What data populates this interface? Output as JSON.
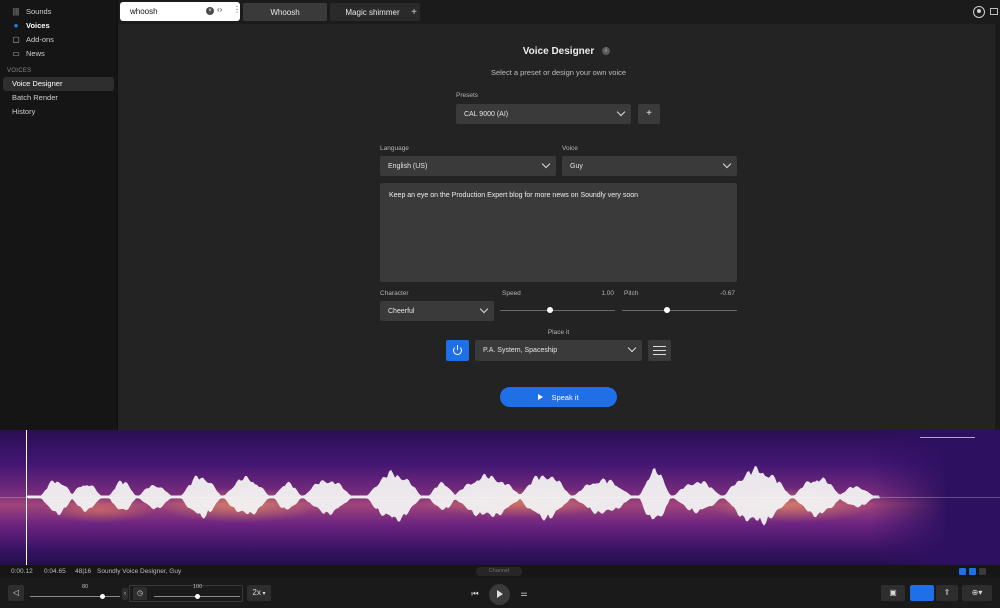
{
  "sidebar": {
    "nav": [
      {
        "label": "Sounds",
        "icon": "library-icon"
      },
      {
        "label": "Voices",
        "icon": "speech-bubble-icon"
      },
      {
        "label": "Add-ons",
        "icon": "bag-icon"
      },
      {
        "label": "News",
        "icon": "monitor-icon"
      }
    ],
    "section": "VOICES",
    "links": [
      "Voice Designer",
      "Batch Render",
      "History"
    ]
  },
  "topbar": {
    "search_value": "whoosh",
    "tabs": [
      "Whoosh",
      "Magic shimmer"
    ],
    "add_tab": "+"
  },
  "designer": {
    "title": "Voice Designer",
    "subtitle": "Select a preset or design your own voice",
    "presets_label": "Presets",
    "preset_value": "CAL 9000 (AI)",
    "add_preset": "+",
    "language_label": "Language",
    "language_value": "English (US)",
    "voice_label": "Voice",
    "voice_value": "Guy",
    "text": "Keep an eye on the Production Expert blog for more news on Soundly very soon",
    "character_label": "Character",
    "character_value": "Cheerful",
    "speed_label": "Speed",
    "speed_value": "1.00",
    "pitch_label": "Pitch",
    "pitch_value": "-0.67",
    "place_label": "Place it",
    "place_value": "P.A. System, Spaceship",
    "speak_label": "Speak it"
  },
  "status": {
    "position": "0:00.12",
    "duration": "0:04.65",
    "format": "48|16",
    "source": "Soundly Voice Designer, Guy",
    "channel": "Channel"
  },
  "transport": {
    "volume": "80",
    "speed": "100",
    "rate": "2x",
    "volume_level": 0.8,
    "speed_level": 0.5
  },
  "colors": {
    "accent": "#1f6fe6",
    "panel": "#232323",
    "input": "#3a3a3a"
  }
}
